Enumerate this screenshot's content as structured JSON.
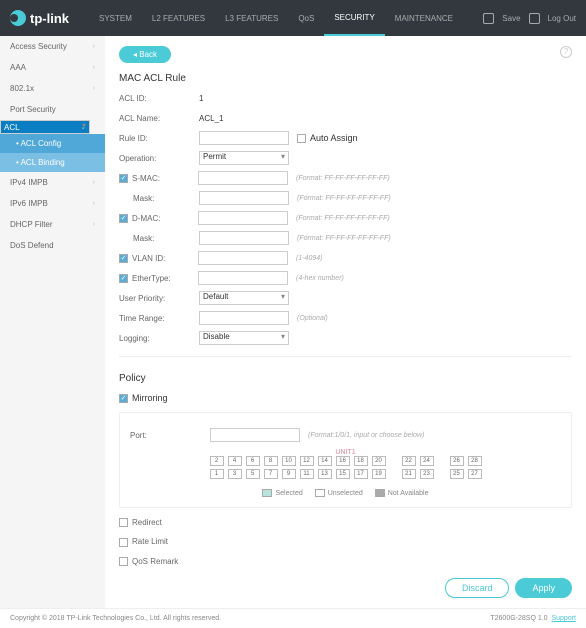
{
  "header": {
    "brand": "tp-link",
    "nav": [
      "SYSTEM",
      "L2 FEATURES",
      "L3 FEATURES",
      "QoS",
      "SECURITY",
      "MAINTENANCE"
    ],
    "active": 4,
    "save": "Save",
    "logout": "Log Out"
  },
  "sidebar": {
    "items": [
      {
        "label": "Access Security",
        "chev": true
      },
      {
        "label": "AAA",
        "chev": true
      },
      {
        "label": "802.1x",
        "chev": true
      },
      {
        "label": "Port Security",
        "chev": false
      },
      {
        "label": "ACL",
        "chev": true,
        "selected": true
      },
      {
        "label": "IPv4 IMPB",
        "chev": true
      },
      {
        "label": "IPv6 IMPB",
        "chev": true
      },
      {
        "label": "DHCP Filter",
        "chev": true
      },
      {
        "label": "DoS Defend",
        "chev": false
      }
    ],
    "subs": [
      {
        "label": "ACL Config",
        "active": true
      },
      {
        "label": "ACL Binding",
        "active": false
      }
    ]
  },
  "page": {
    "back": "Back",
    "title": "MAC ACL Rule",
    "fields": {
      "acl_id_label": "ACL ID:",
      "acl_id": "1",
      "acl_name_label": "ACL Name:",
      "acl_name": "ACL_1",
      "rule_id_label": "Rule ID:",
      "auto_assign": "Auto Assign",
      "operation_label": "Operation:",
      "operation": "Permit",
      "smac_label": "S-MAC:",
      "smac_hint": "(Format: FF-FF-FF-FF-FF-FF)",
      "mask_label": "Mask:",
      "dmac_label": "D-MAC:",
      "dmac_hint": "(Format: FF-FF-FF-FF-FF-FF)",
      "mask2_hint": "(Format: FF-FF-FF-FF-FF-FF)",
      "mask3_hint": "(Format: FF-FF-FF-FF-FF-FF)",
      "vlan_label": "VLAN ID:",
      "vlan_hint": "(1-4094)",
      "ether_label": "EtherType:",
      "ether_hint": "(4-hex number)",
      "prio_label": "User Priority:",
      "prio": "Default",
      "time_label": "Time Range:",
      "time_hint": "(Optional)",
      "log_label": "Logging:",
      "log": "Disable"
    },
    "policy": {
      "title": "Policy",
      "mirroring": "Mirroring",
      "port_label": "Port:",
      "port_hint": "(Format:1/0/1, input or choose below)",
      "unit": "UNIT1",
      "ports_top": [
        "2",
        "4",
        "6",
        "8",
        "10",
        "12",
        "14",
        "16",
        "18",
        "20",
        "",
        "22",
        "24",
        "",
        "26",
        "28"
      ],
      "ports_bot": [
        "1",
        "3",
        "5",
        "7",
        "9",
        "11",
        "13",
        "15",
        "17",
        "19",
        "",
        "21",
        "23",
        "",
        "25",
        "27"
      ],
      "legend": {
        "selected": "Selected",
        "unselected": "Unselected",
        "na": "Not Available"
      },
      "redirect": "Redirect",
      "rate": "Rate Limit",
      "qos": "QoS Remark"
    },
    "actions": {
      "discard": "Discard",
      "apply": "Apply"
    }
  },
  "footer": {
    "left": "Copyright © 2018    TP-Link Technologies Co., Ltd. All rights reserved.",
    "model": "T2600G-28SQ 1.0",
    "support": "Support"
  }
}
